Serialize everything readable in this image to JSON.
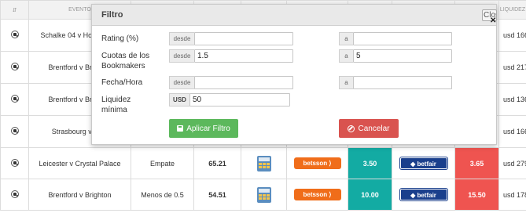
{
  "table": {
    "headers": [
      "",
      "EVENTO",
      "",
      "",
      "",
      "",
      "",
      "",
      "",
      "LIQUIDEZ"
    ],
    "hidden_rows": [
      {
        "event": "Schalke 04 v Hoffenheim",
        "liquidity": "usd 166"
      },
      {
        "event": "Brentford v Brighton",
        "liquidity": "usd 217"
      },
      {
        "event": "Brentford v Brighton",
        "liquidity": "usd 136"
      },
      {
        "event": "Strasbourg v Nice",
        "liquidity": "usd 166"
      }
    ],
    "visible_rows": [
      {
        "event": "Leicester v Crystal Palace",
        "market": "Empate",
        "rating": "65.21",
        "bookmaker": "betsson",
        "back_odds": "3.50",
        "exchange": "betfair",
        "lay_odds": "3.65",
        "liquidity": "usd 279"
      },
      {
        "event": "Brentford v Brighton",
        "market": "Menos de 0.5",
        "rating": "54.51",
        "bookmaker": "betsson",
        "back_odds": "10.00",
        "exchange": "betfair",
        "lay_odds": "15.50",
        "liquidity": "usd 178"
      }
    ]
  },
  "modal": {
    "title": "Filtro",
    "close_label": "Close",
    "rating": {
      "label": "Rating (%)",
      "from_label": "desde",
      "from_value": "",
      "to_label": "a",
      "to_value": ""
    },
    "odds": {
      "label": "Cuotas de los Bookmakers",
      "from_label": "desde",
      "from_value": "1.5",
      "to_label": "a",
      "to_value": "5"
    },
    "date": {
      "label": "Fecha/Hora",
      "from_label": "desde",
      "from_value": "",
      "to_label": "a",
      "to_value": ""
    },
    "liquidity": {
      "label": "Liquidez mínima",
      "currency": "USD",
      "value": "50"
    },
    "apply_label": "Aplicar Filtro",
    "cancel_label": "Cancelar"
  },
  "colors": {
    "back": "#13aba3",
    "lay": "#ef5450",
    "apply": "#5cb85c",
    "cancel": "#d9534f",
    "betsson": "#f06d1a",
    "betfair": "#1a3f8c"
  }
}
